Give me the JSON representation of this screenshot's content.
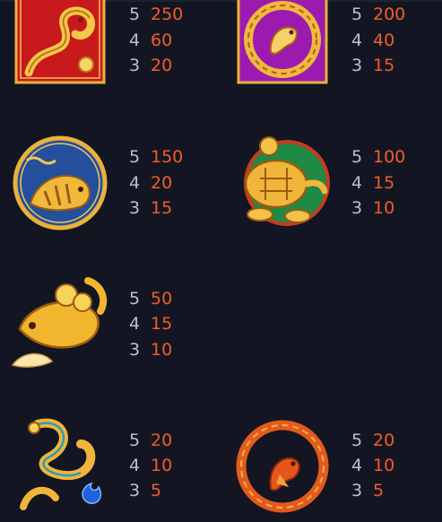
{
  "colors": {
    "background": "#131622",
    "count_text": "#b8c0d6",
    "payout_text": "#f25c28",
    "gold": "#e9b23a",
    "dragon_bg": "#c8191c",
    "phoenix_bg": "#9b1bb0",
    "tiger_bg": "#234f9c",
    "turtle_bg": "#1f8a43"
  },
  "symbols": [
    {
      "icon": "red-dragon-symbol-icon",
      "payouts": [
        {
          "count": "5",
          "value": "250"
        },
        {
          "count": "4",
          "value": "60"
        },
        {
          "count": "3",
          "value": "20"
        }
      ]
    },
    {
      "icon": "purple-phoenix-symbol-icon",
      "payouts": [
        {
          "count": "5",
          "value": "200"
        },
        {
          "count": "4",
          "value": "40"
        },
        {
          "count": "3",
          "value": "15"
        }
      ]
    },
    {
      "icon": "blue-tiger-symbol-icon",
      "payouts": [
        {
          "count": "5",
          "value": "150"
        },
        {
          "count": "4",
          "value": "20"
        },
        {
          "count": "3",
          "value": "15"
        }
      ]
    },
    {
      "icon": "golden-turtle-symbol-icon",
      "payouts": [
        {
          "count": "5",
          "value": "100"
        },
        {
          "count": "4",
          "value": "15"
        },
        {
          "count": "3",
          "value": "10"
        }
      ]
    },
    {
      "icon": "golden-koi-symbol-icon",
      "payouts": [
        {
          "count": "5",
          "value": "50"
        },
        {
          "count": "4",
          "value": "15"
        },
        {
          "count": "3",
          "value": "10"
        }
      ]
    },
    {
      "icon": "golden-dragon-symbol-icon",
      "payouts": [
        {
          "count": "5",
          "value": "20"
        },
        {
          "count": "4",
          "value": "10"
        },
        {
          "count": "3",
          "value": "5"
        }
      ]
    },
    {
      "icon": "red-phoenix-symbol-icon",
      "payouts": [
        {
          "count": "5",
          "value": "20"
        },
        {
          "count": "4",
          "value": "10"
        },
        {
          "count": "3",
          "value": "5"
        }
      ]
    }
  ]
}
